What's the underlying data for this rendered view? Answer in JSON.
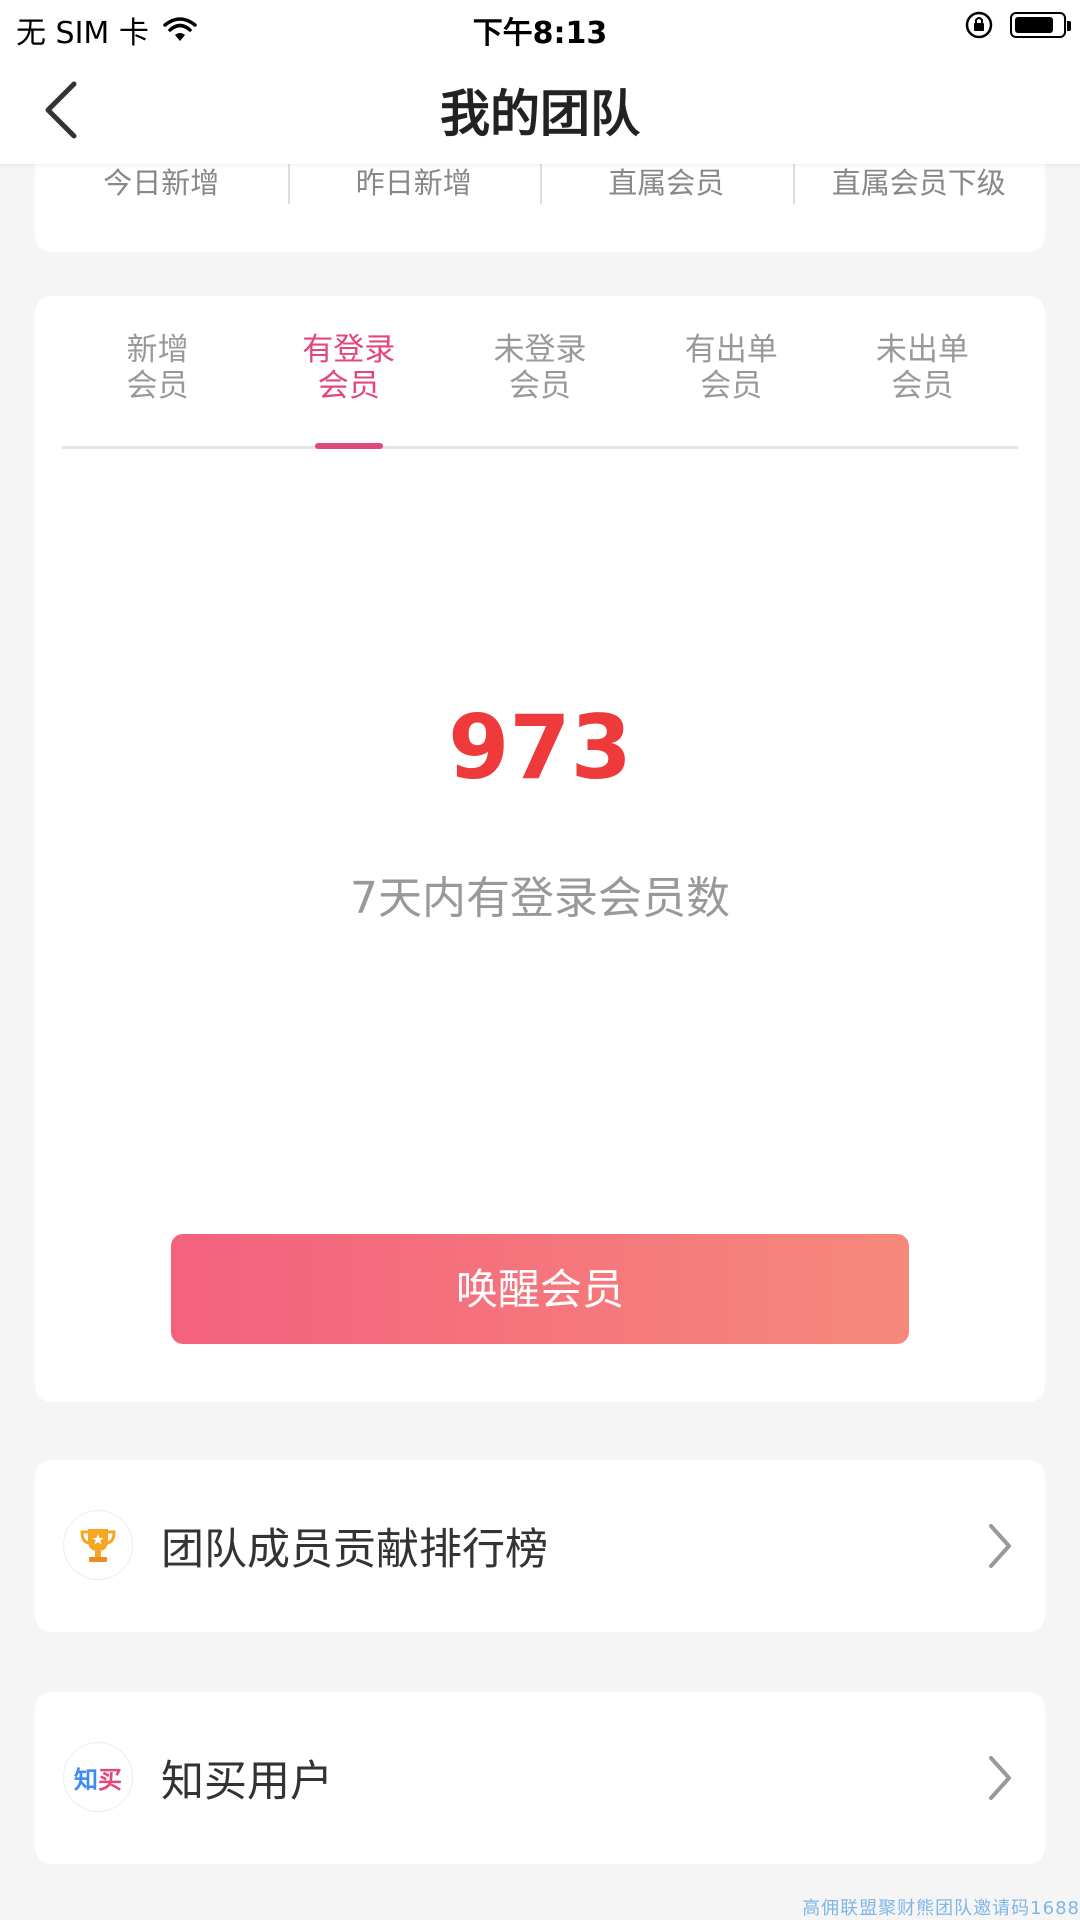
{
  "status_bar": {
    "carrier": "无 SIM 卡",
    "time": "下午8:13"
  },
  "nav": {
    "title": "我的团队",
    "back_icon": "chevron-left-icon"
  },
  "stats_header": {
    "items": [
      "今日新增",
      "昨日新增",
      "直属会员",
      "直属会员下级"
    ]
  },
  "tabs": [
    {
      "line1": "新增",
      "line2": "会员",
      "active": false
    },
    {
      "line1": "有登录",
      "line2": "会员",
      "active": true
    },
    {
      "line1": "未登录",
      "line2": "会员",
      "active": false
    },
    {
      "line1": "有出单",
      "line2": "会员",
      "active": false
    },
    {
      "line1": "未出单",
      "line2": "会员",
      "active": false
    }
  ],
  "metric": {
    "value": "973",
    "description": "7天内有登录会员数"
  },
  "wake_button": {
    "label": "唤醒会员"
  },
  "list": {
    "rank_label": "团队成员贡献排行榜",
    "rank_icon": "trophy-icon",
    "zhimai_label": "知买用户",
    "zhimai_icon": "zhimai-logo-icon",
    "zhimai_logo_text_1": "知",
    "zhimai_logo_text_2": "买"
  },
  "watermark": "高佣联盟聚财熊团队邀请码1688",
  "colors": {
    "accent_pink": "#e2487a",
    "metric_red": "#ee3a3a",
    "button_gradient_start": "#f4617e",
    "button_gradient_end": "#f6897b"
  }
}
